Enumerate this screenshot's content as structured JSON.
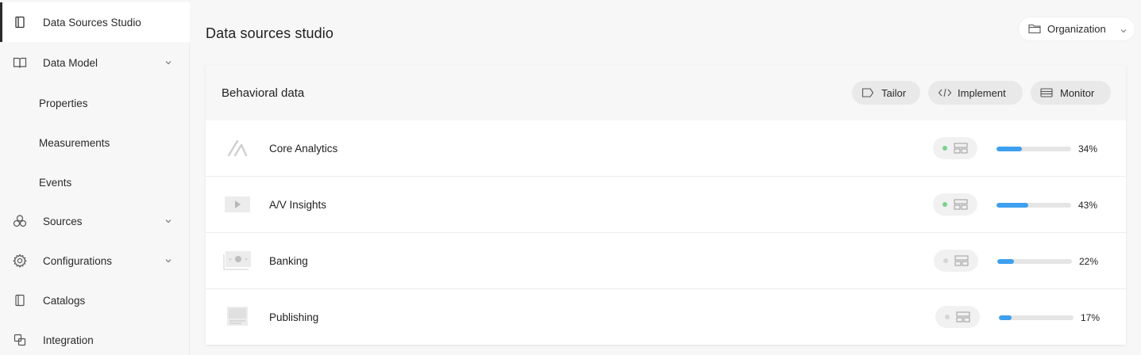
{
  "sidebar": {
    "items": [
      {
        "label": "Data Sources Studio",
        "icon": "book-icon",
        "active": true
      },
      {
        "label": "Data Model",
        "icon": "open-book-icon",
        "expandable": true
      },
      {
        "label": "Properties"
      },
      {
        "label": "Measurements"
      },
      {
        "label": "Events"
      },
      {
        "label": "Sources",
        "icon": "nodes-icon",
        "expandable": true
      },
      {
        "label": "Configurations",
        "icon": "gear-icon",
        "expandable": true
      },
      {
        "label": "Catalogs",
        "icon": "catalog-icon"
      },
      {
        "label": "Integration",
        "icon": "integration-icon"
      }
    ]
  },
  "header": {
    "title": "Data sources studio",
    "scope_select": {
      "label": "Organization",
      "icon": "folder-icon"
    }
  },
  "card": {
    "title": "Behavioral data",
    "actions": [
      {
        "label": "Tailor",
        "icon": "tag-icon"
      },
      {
        "label": "Implement",
        "icon": "code-icon"
      },
      {
        "label": "Monitor",
        "icon": "monitor-icon"
      }
    ],
    "rows": [
      {
        "name": "Core Analytics",
        "thumb": "analytics-logo-icon",
        "status_active": true,
        "progress": 0.34,
        "progress_label": "34%"
      },
      {
        "name": "A/V Insights",
        "thumb": "play-video-icon",
        "status_active": true,
        "progress": 0.43,
        "progress_label": "43%"
      },
      {
        "name": "Banking",
        "thumb": "banknote-icon",
        "status_active": false,
        "progress": 0.22,
        "progress_label": "22%"
      },
      {
        "name": "Publishing",
        "thumb": "document-page-icon",
        "status_active": false,
        "progress": 0.17,
        "progress_label": "17%"
      }
    ]
  },
  "colors": {
    "accent_bar": "#3ea0ef",
    "status_active": "#7cd08f",
    "status_inactive": "#d6d6d6"
  }
}
